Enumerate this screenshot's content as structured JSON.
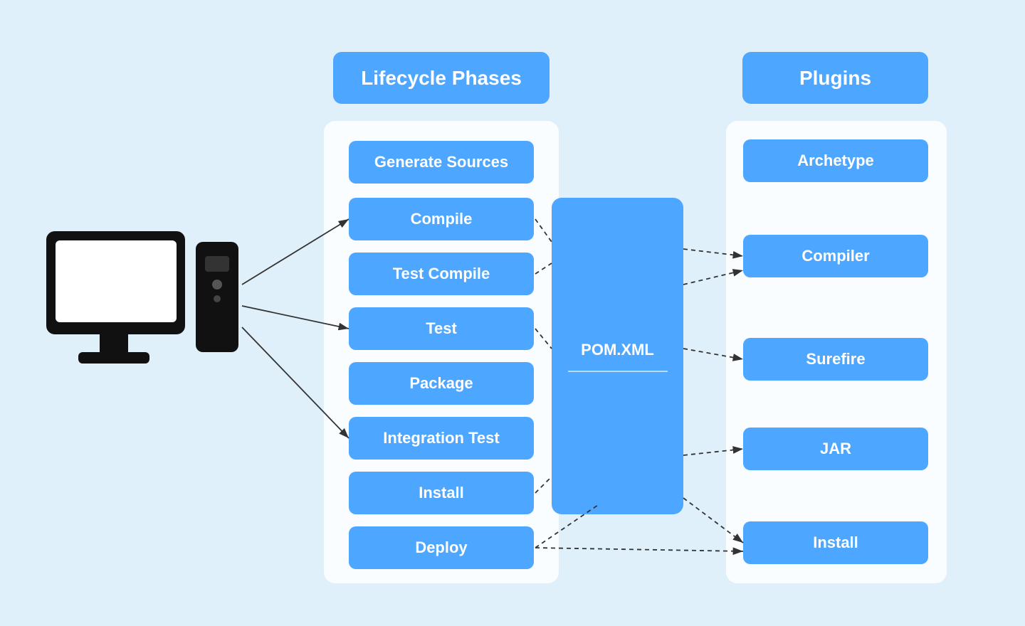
{
  "headers": {
    "lifecycle": "Lifecycle Phases",
    "plugins": "Plugins"
  },
  "phases": [
    {
      "id": "generate",
      "label": "Generate Sources"
    },
    {
      "id": "compile",
      "label": "Compile"
    },
    {
      "id": "testcompile",
      "label": "Test Compile"
    },
    {
      "id": "test",
      "label": "Test"
    },
    {
      "id": "package",
      "label": "Package"
    },
    {
      "id": "inttest",
      "label": "Integration Test"
    },
    {
      "id": "install",
      "label": "Install"
    },
    {
      "id": "deploy",
      "label": "Deploy"
    }
  ],
  "pom": {
    "label": "POM.XML"
  },
  "plugins": [
    {
      "id": "archetype",
      "label": "Archetype"
    },
    {
      "id": "compiler",
      "label": "Compiler"
    },
    {
      "id": "surefire",
      "label": "Surefire"
    },
    {
      "id": "jar",
      "label": "JAR"
    },
    {
      "id": "install",
      "label": "Install"
    }
  ]
}
